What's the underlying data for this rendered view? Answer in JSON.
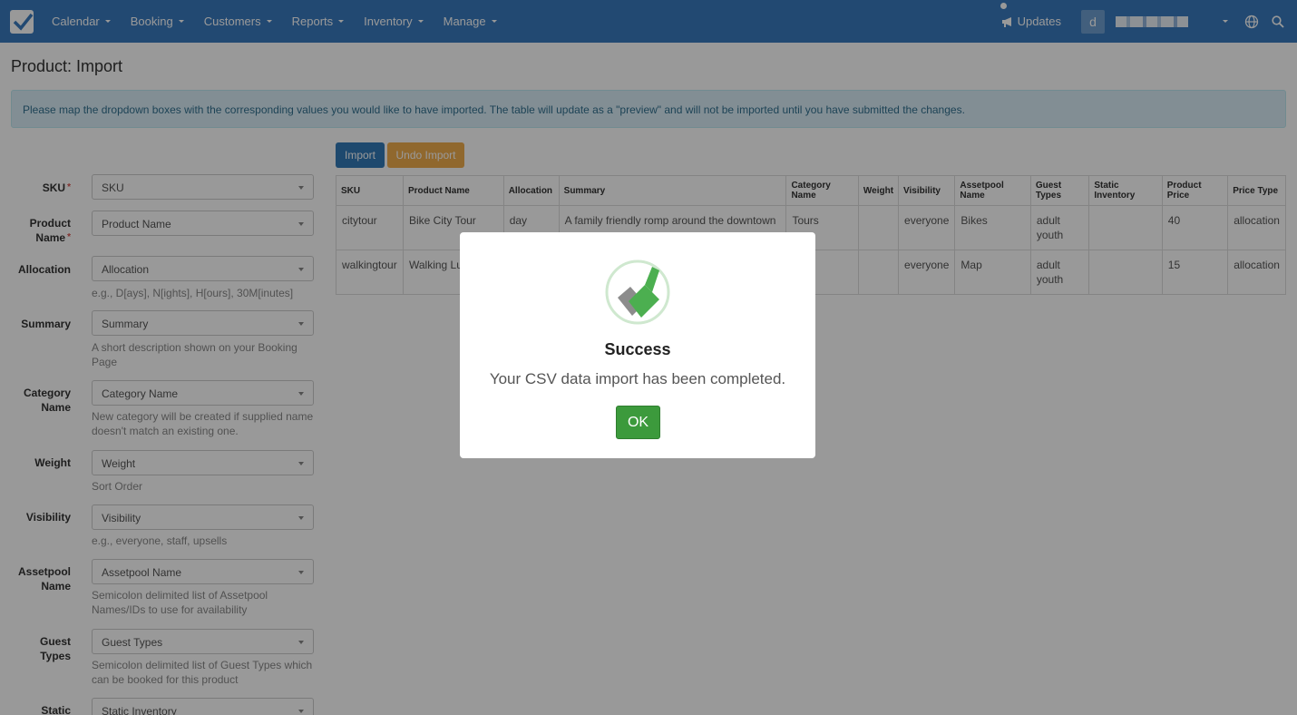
{
  "nav": {
    "items": [
      {
        "label": "Calendar"
      },
      {
        "label": "Booking"
      },
      {
        "label": "Customers"
      },
      {
        "label": "Reports"
      },
      {
        "label": "Inventory"
      },
      {
        "label": "Manage"
      }
    ],
    "updates_label": "Updates",
    "avatar_letter": "d"
  },
  "page": {
    "title": "Product: Import",
    "info": "Please map the dropdown boxes with the corresponding values you would like to have imported. The table will update as a \"preview\" and will not be imported until you have submitted the changes."
  },
  "form": {
    "sku": {
      "label": "SKU",
      "value": "SKU"
    },
    "product_name": {
      "label1": "Product",
      "label2": "Name",
      "value": "Product Name"
    },
    "allocation": {
      "label": "Allocation",
      "value": "Allocation",
      "help": "e.g., D[ays], N[ights], H[ours], 30M[inutes]"
    },
    "summary": {
      "label": "Summary",
      "value": "Summary",
      "help": "A short description shown on your Booking Page"
    },
    "category": {
      "label1": "Category",
      "label2": "Name",
      "value": "Category Name",
      "help": "New category will be created if supplied name doesn't match an existing one."
    },
    "weight": {
      "label": "Weight",
      "value": "Weight",
      "help": "Sort Order"
    },
    "visibility": {
      "label": "Visibility",
      "value": "Visibility",
      "help": "e.g., everyone, staff, upsells"
    },
    "assetpool": {
      "label1": "Assetpool",
      "label2": "Name",
      "value": "Assetpool Name",
      "help": "Semicolon delimited list of Assetpool Names/IDs to use for availability"
    },
    "guest_types": {
      "label1": "Guest",
      "label2": "Types",
      "value": "Guest Types",
      "help": "Semicolon delimited list of Guest Types which can be booked for this product"
    },
    "static": {
      "label": "Static",
      "value": "Static Inventory"
    }
  },
  "buttons": {
    "import": "Import",
    "undo": "Undo Import"
  },
  "table": {
    "headers": [
      "SKU",
      "Product Name",
      "Allocation",
      "Summary",
      "Category Name",
      "Weight",
      "Visibility",
      "Assetpool Name",
      "Guest Types",
      "Static Inventory",
      "Product Price",
      "Price Type"
    ],
    "rows": [
      [
        "citytour",
        "Bike City Tour",
        "day",
        "A family friendly romp around the downtown core",
        "Tours",
        "",
        "everyone",
        "Bikes",
        "adult youth",
        "",
        "40",
        "allocation"
      ],
      [
        "walkingtour",
        "Walking Lu Tour",
        "",
        "",
        "rs",
        "",
        "everyone",
        "Map",
        "adult youth",
        "",
        "15",
        "allocation"
      ]
    ]
  },
  "modal": {
    "title": "Success",
    "text": "Your CSV data import has been completed.",
    "ok": "OK"
  },
  "colors": {
    "navbar": "#3a7bbf",
    "success": "#3c9a3c",
    "import_btn": "#337ab7",
    "undo_btn": "#f0ad4e"
  }
}
